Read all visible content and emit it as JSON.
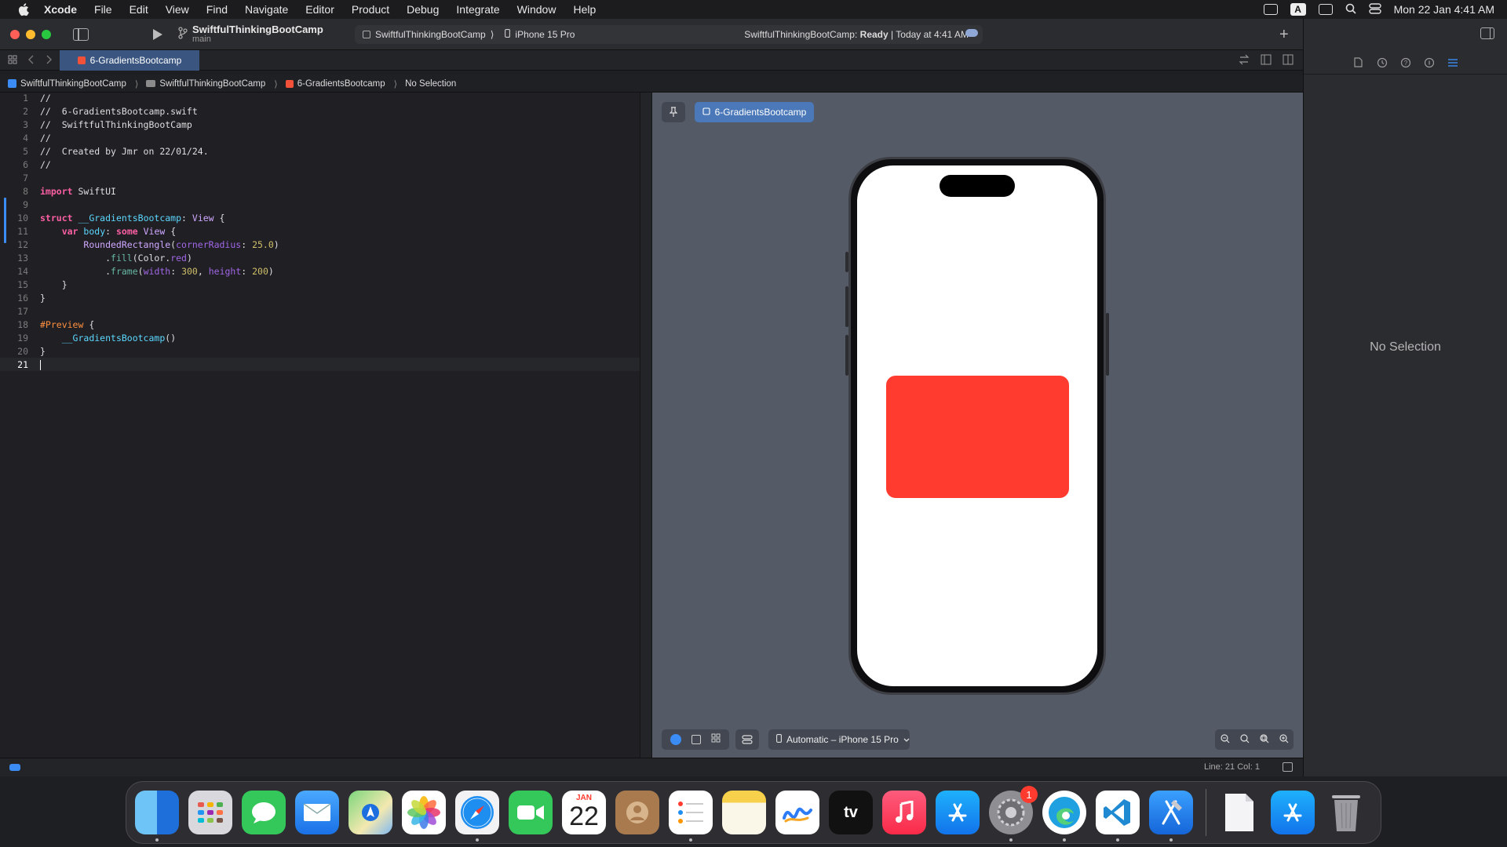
{
  "menubar": {
    "app_name": "Xcode",
    "items": [
      "File",
      "Edit",
      "View",
      "Find",
      "Navigate",
      "Editor",
      "Product",
      "Debug",
      "Integrate",
      "Window",
      "Help"
    ],
    "input_source": "A",
    "clock": "Mon 22 Jan  4:41 AM"
  },
  "toolbar": {
    "project_name": "SwiftfulThinkingBootCamp",
    "branch": "main",
    "scheme_target": "SwiftfulThinkingBootCamp",
    "scheme_sep": "⟩",
    "device": "iPhone 15 Pro",
    "status_prefix": "SwiftfulThinkingBootCamp:",
    "status_state": "Ready",
    "status_suffix": "| Today at 4:41 AM",
    "add_label": "+"
  },
  "tabbar": {
    "active_tab": "6-GradientsBootcamp"
  },
  "jumpbar": {
    "crumbs": [
      "SwiftfulThinkingBootCamp",
      "SwiftfulThinkingBootCamp",
      "6-GradientsBootcamp",
      "No Selection"
    ],
    "sep": "⟩"
  },
  "editor": {
    "line_numbers": [
      "1",
      "2",
      "3",
      "4",
      "5",
      "6",
      "7",
      "8",
      "9",
      "10",
      "11",
      "12",
      "13",
      "14",
      "15",
      "16",
      "17",
      "18",
      "19",
      "20",
      "21"
    ],
    "code": {
      "l1": "//",
      "l2": "//  6-GradientsBootcamp.swift",
      "l3": "//  SwiftfulThinkingBootCamp",
      "l4": "//",
      "l5": "//  Created by Jmr on 22/01/24.",
      "l6": "//",
      "l8_kw": "import",
      "l8_rest": " SwiftUI",
      "l10_kw": "struct",
      "l10_name": "__GradientsBootcamp",
      "l10_colon": ": ",
      "l10_type": "View",
      "l10_brace": " {",
      "l11_kw": "var",
      "l11_name": "body",
      "l11_colon": ": ",
      "l11_kw2": "some",
      "l11_type": "View",
      "l11_brace": " {",
      "l12_type": "RoundedRectangle",
      "l12_open": "(",
      "l12_param": "cornerRadius",
      "l12_colon": ": ",
      "l12_num": "25.0",
      "l12_close": ")",
      "l13_dot": ".",
      "l13_fn": "fill",
      "l13_open": "(Color.",
      "l13_prop": "red",
      "l13_close": ")",
      "l14_dot": ".",
      "l14_fn": "frame",
      "l14_open": "(",
      "l14_p1": "width",
      "l14_c1": ": ",
      "l14_n1": "300",
      "l14_comma": ", ",
      "l14_p2": "height",
      "l14_c2": ": ",
      "l14_n2": "200",
      "l14_close": ")",
      "l15": "}",
      "l16": "}",
      "l18_macro": "#Preview",
      "l18_brace": " {",
      "l19_call": "__GradientsBootcamp",
      "l19_paren": "()",
      "l20": "}"
    }
  },
  "canvas": {
    "preview_label": "6-GradientsBootcamp",
    "device_selector": "Automatic – iPhone 15 Pro",
    "shape_color": "#ff3b30"
  },
  "statusbar": {
    "position": "Line: 21  Col: 1"
  },
  "inspector": {
    "empty_label": "No Selection"
  },
  "dock": {
    "calendar_month": "JAN",
    "calendar_day": "22",
    "settings_badge": "1",
    "tv_label": "tv"
  }
}
